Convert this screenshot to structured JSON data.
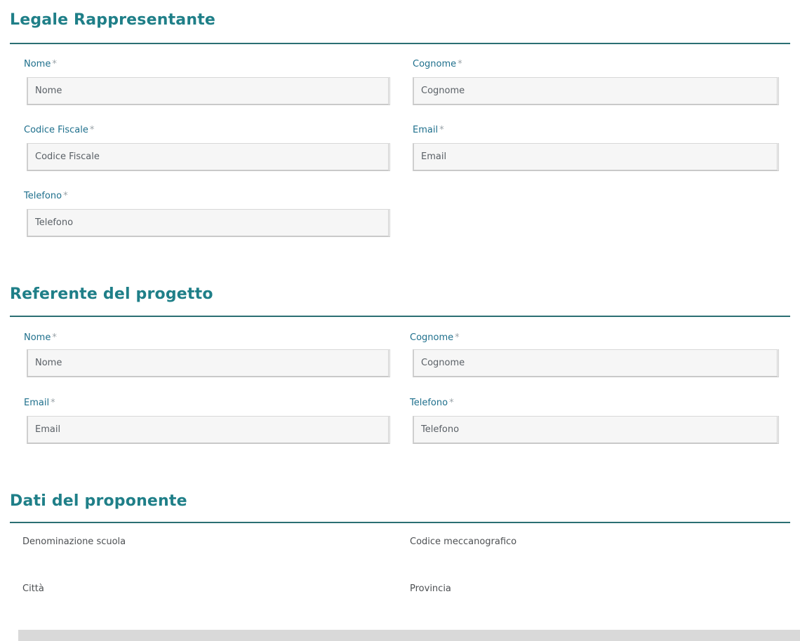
{
  "legale_rappresentante": {
    "title": "Legale Rappresentante",
    "nome": {
      "label": "Nome",
      "required": "*",
      "placeholder": "Nome"
    },
    "cognome": {
      "label": "Cognome",
      "required": "*",
      "placeholder": "Cognome"
    },
    "codice_fiscale": {
      "label": "Codice Fiscale",
      "required": "*",
      "placeholder": "Codice Fiscale"
    },
    "email": {
      "label": "Email",
      "required": "*",
      "placeholder": "Email"
    },
    "telefono": {
      "label": "Telefono",
      "required": "*",
      "placeholder": "Telefono"
    }
  },
  "referente": {
    "title": "Referente del progetto",
    "nome": {
      "label": "Nome",
      "required": "*",
      "placeholder": "Nome"
    },
    "cognome": {
      "label": "Cognome",
      "required": "*",
      "placeholder": "Cognome"
    },
    "email": {
      "label": "Email",
      "required": "*",
      "placeholder": "Email"
    },
    "telefono": {
      "label": "Telefono",
      "required": "*",
      "placeholder": "Telefono"
    }
  },
  "proponente": {
    "title": "Dati del proponente",
    "denominazione": "Denominazione scuola",
    "codice_meccanografico": "Codice meccanografico",
    "citta": "Città",
    "provincia": "Provincia"
  }
}
